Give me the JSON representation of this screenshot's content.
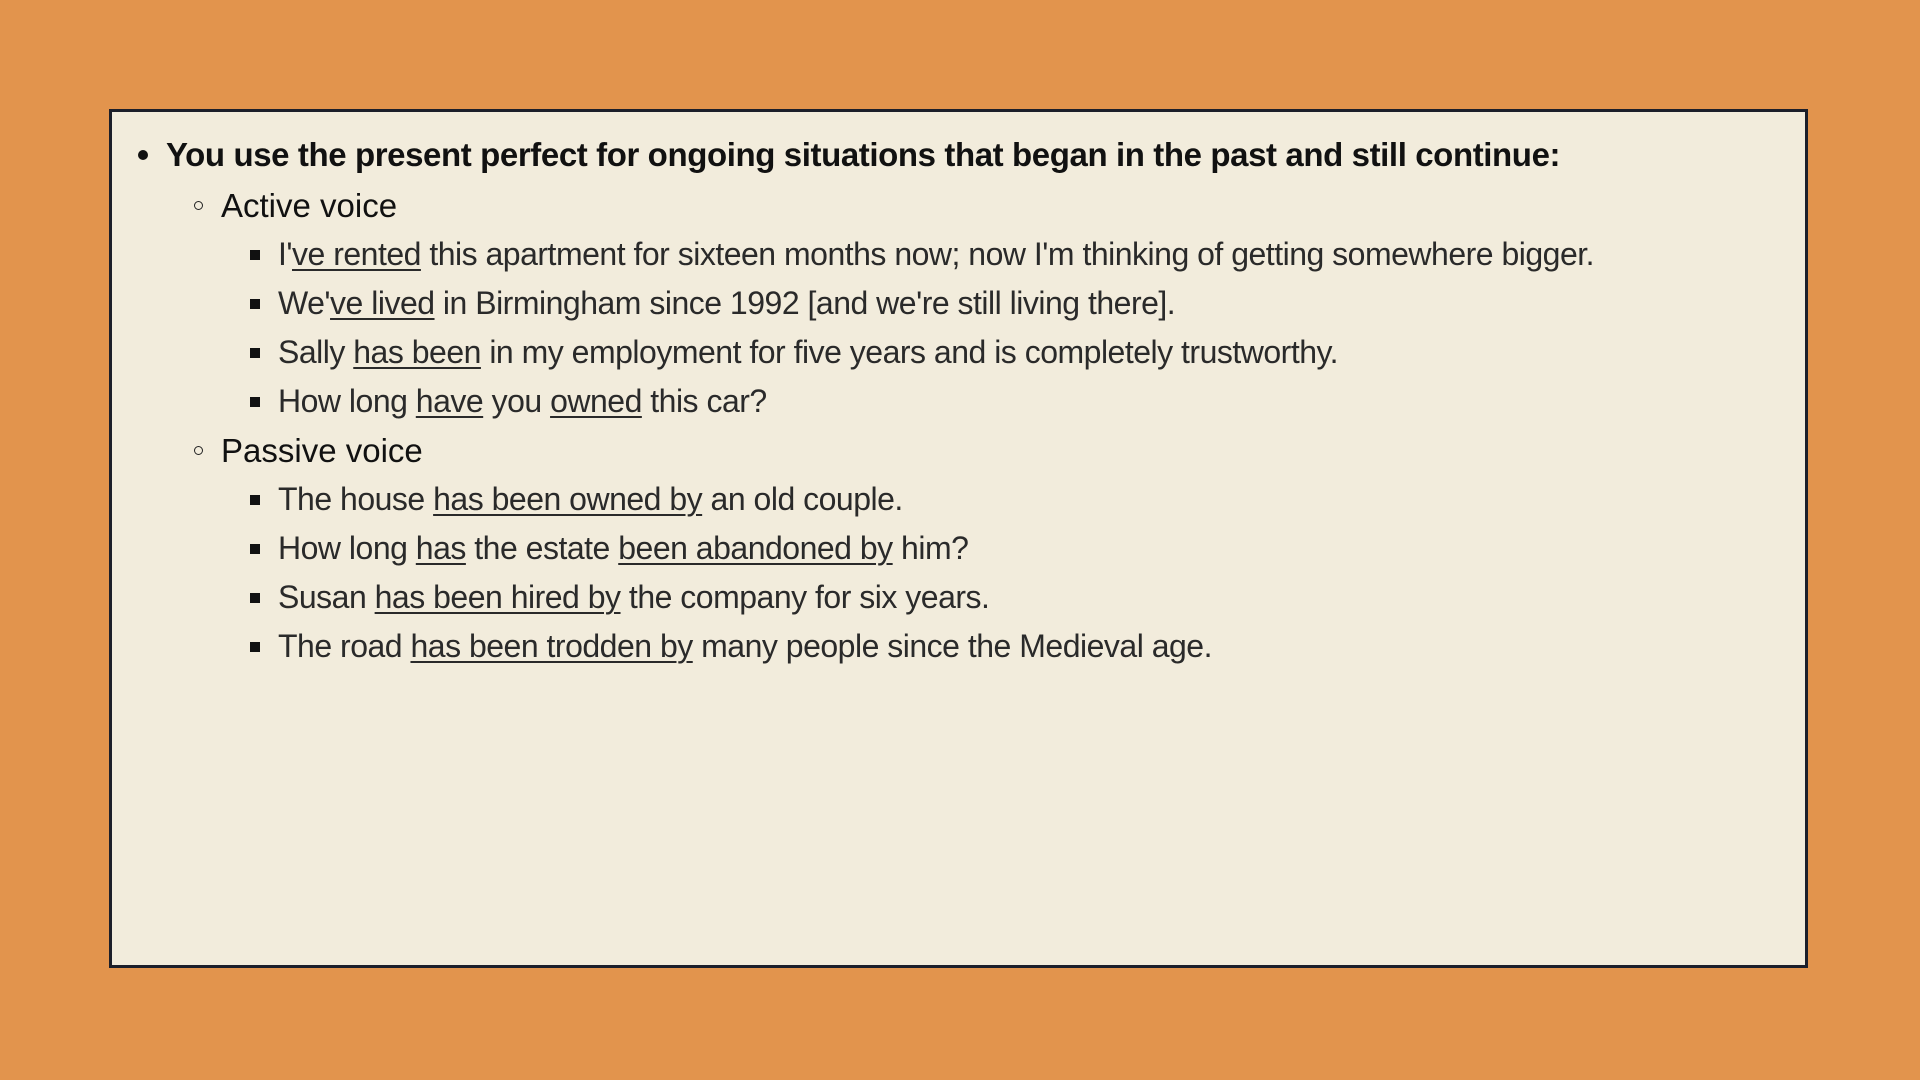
{
  "slide": {
    "heading": "You use the present perfect for ongoing situations that began in the past and still continue:",
    "active": {
      "title": "Active voice",
      "examples": [
        [
          {
            "t": "I'",
            "u": false
          },
          {
            "t": "ve rented",
            "u": true
          },
          {
            "t": " this apartment for sixteen months now; now I'm thinking of getting somewhere bigger.",
            "u": false
          }
        ],
        [
          {
            "t": "We'",
            "u": false
          },
          {
            "t": "ve lived",
            "u": true
          },
          {
            "t": " in Birmingham since 1992 [and we're still living there].",
            "u": false
          }
        ],
        [
          {
            "t": "Sally ",
            "u": false
          },
          {
            "t": "has been",
            "u": true
          },
          {
            "t": " in my employment for five years and is completely trustworthy.",
            "u": false
          }
        ],
        [
          {
            "t": "How long ",
            "u": false
          },
          {
            "t": "have",
            "u": true
          },
          {
            "t": " you ",
            "u": false
          },
          {
            "t": "owned",
            "u": true
          },
          {
            "t": " this car?",
            "u": false
          }
        ]
      ]
    },
    "passive": {
      "title": "Passive voice",
      "examples": [
        [
          {
            "t": "The house ",
            "u": false
          },
          {
            "t": "has been owned by",
            "u": true
          },
          {
            "t": " an old couple.",
            "u": false
          }
        ],
        [
          {
            "t": "How long ",
            "u": false
          },
          {
            "t": "has",
            "u": true
          },
          {
            "t": " the estate ",
            "u": false
          },
          {
            "t": "been abandoned by",
            "u": true
          },
          {
            "t": " him?",
            "u": false
          }
        ],
        [
          {
            "t": "Susan ",
            "u": false
          },
          {
            "t": "has been hired by",
            "u": true
          },
          {
            "t": " the company for six years.",
            "u": false
          }
        ],
        [
          {
            "t": "The road ",
            "u": false
          },
          {
            "t": "has been trodden by",
            "u": true
          },
          {
            "t": " many people since the Medieval age.",
            "u": false
          }
        ]
      ]
    }
  },
  "colors": {
    "background": "#e2944d",
    "card": "#f2ecdc",
    "border": "#1c1f2a"
  }
}
